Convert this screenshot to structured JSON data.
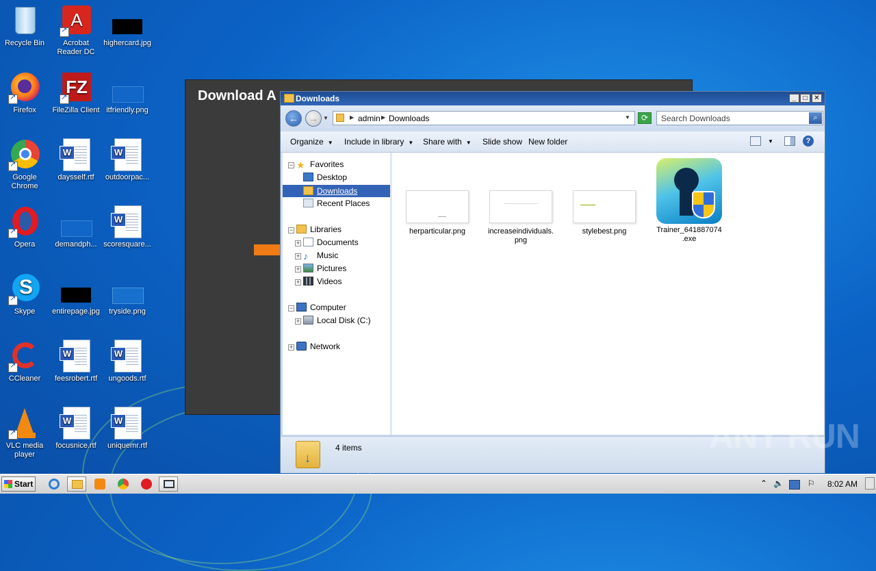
{
  "desktop": {
    "icons": [
      {
        "label": "Recycle Bin",
        "icon": "recycle-bin-icon"
      },
      {
        "label": "Acrobat Reader DC",
        "icon": "acrobat-icon"
      },
      {
        "label": "highercard.jpg",
        "icon": "image-file-icon"
      },
      {
        "label": "Firefox",
        "icon": "firefox-icon"
      },
      {
        "label": "FileZilla Client",
        "icon": "filezilla-icon"
      },
      {
        "label": "itfriendly.png",
        "icon": "image-file-icon"
      },
      {
        "label": "Google Chrome",
        "icon": "chrome-icon"
      },
      {
        "label": "daysself.rtf",
        "icon": "word-document-icon"
      },
      {
        "label": "outdoorpac...",
        "icon": "word-document-icon"
      },
      {
        "label": "Opera",
        "icon": "opera-icon"
      },
      {
        "label": "demandph...",
        "icon": "image-file-icon"
      },
      {
        "label": "scoresquare...",
        "icon": "word-document-icon"
      },
      {
        "label": "Skype",
        "icon": "skype-icon"
      },
      {
        "label": "entirepage.jpg",
        "icon": "image-file-icon"
      },
      {
        "label": "tryside.png",
        "icon": "image-file-icon"
      },
      {
        "label": "CCleaner",
        "icon": "ccleaner-icon"
      },
      {
        "label": "feesrobert.rtf",
        "icon": "word-document-icon"
      },
      {
        "label": "ungoods.rtf",
        "icon": "word-document-icon"
      },
      {
        "label": "VLC media player",
        "icon": "vlc-icon"
      },
      {
        "label": "focusnice.rtf",
        "icon": "word-document-icon"
      },
      {
        "label": "uniquemr.rtf",
        "icon": "word-document-icon"
      }
    ]
  },
  "background_window": {
    "title": "Download A"
  },
  "explorer": {
    "title": "Downloads",
    "breadcrumb": [
      "admin",
      "Downloads"
    ],
    "search_placeholder": "Search Downloads",
    "toolbar": {
      "organize": "Organize",
      "include_in_library": "Include in library",
      "share_with": "Share with",
      "slide_show": "Slide show",
      "new_folder": "New folder"
    },
    "nav": {
      "favorites": "Favorites",
      "desktop": "Desktop",
      "downloads": "Downloads",
      "recent_places": "Recent Places",
      "libraries": "Libraries",
      "documents": "Documents",
      "music": "Music",
      "pictures": "Pictures",
      "videos": "Videos",
      "computer": "Computer",
      "local_disk": "Local Disk (C:)",
      "network": "Network"
    },
    "files": [
      {
        "name": "herparticular.png",
        "type": "png"
      },
      {
        "name": "increaseindividuals.\npng",
        "type": "png"
      },
      {
        "name": "stylebest.png",
        "type": "png"
      },
      {
        "name": "Trainer_641887074\n.exe",
        "type": "exe"
      }
    ],
    "status": "4 items"
  },
  "taskbar": {
    "start_label": "Start",
    "clock": "8:02 AM"
  },
  "watermark": "ANY RUN",
  "colors": {
    "selection": "#3363b6",
    "titlebar": "#1d4d94",
    "desktop": "#0b63c6"
  }
}
